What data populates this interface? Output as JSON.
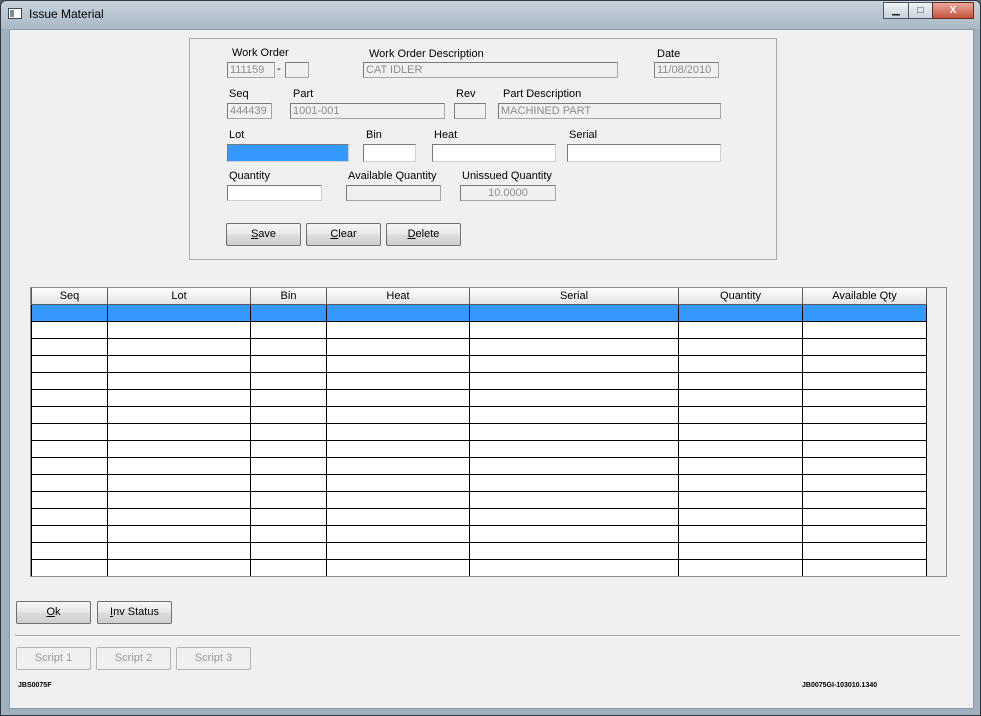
{
  "window": {
    "title": "Issue Material",
    "minimize_glyph": "▁",
    "maximize_glyph": "□",
    "close_glyph": "X",
    "icon": "window-app-icon"
  },
  "form": {
    "work_order_label": "Work Order",
    "work_order": "111159",
    "work_order_dash": "-",
    "work_order_suffix": "",
    "wo_desc_label": "Work Order Description",
    "wo_desc": "CAT IDLER",
    "date_label": "Date",
    "date": "11/08/2010",
    "seq_label": "Seq",
    "seq": "444439",
    "part_label": "Part",
    "part": "1001-001",
    "rev_label": "Rev",
    "rev": "",
    "part_desc_label": "Part Description",
    "part_desc": "MACHINED PART",
    "lot_label": "Lot",
    "lot": "",
    "bin_label": "Bin",
    "bin": "",
    "heat_label": "Heat",
    "heat": "",
    "serial_label": "Serial",
    "serial": "",
    "quantity_label": "Quantity",
    "quantity": "",
    "avail_qty_label": "Available Quantity",
    "avail_qty": "",
    "unissued_qty_label": "Unissued Quantity",
    "unissued_qty": "10.0000"
  },
  "buttons": {
    "save_u": "S",
    "save_rest": "ave",
    "clear_u": "C",
    "clear_rest": "lear",
    "delete_u": "D",
    "delete_rest": "elete",
    "ok_u": "O",
    "ok_rest": "k",
    "inv_u": "I",
    "inv_rest": "nv Status",
    "script1": "Script 1",
    "script2": "Script 2",
    "script3": "Script 3"
  },
  "grid": {
    "columns": [
      "Seq",
      "Lot",
      "Bin",
      "Heat",
      "Serial",
      "Quantity",
      "Available Qty"
    ],
    "selected_row": 0
  },
  "footer": {
    "left_code": "JBS0075F",
    "right_code": "JB0075GI-103010.1340"
  }
}
